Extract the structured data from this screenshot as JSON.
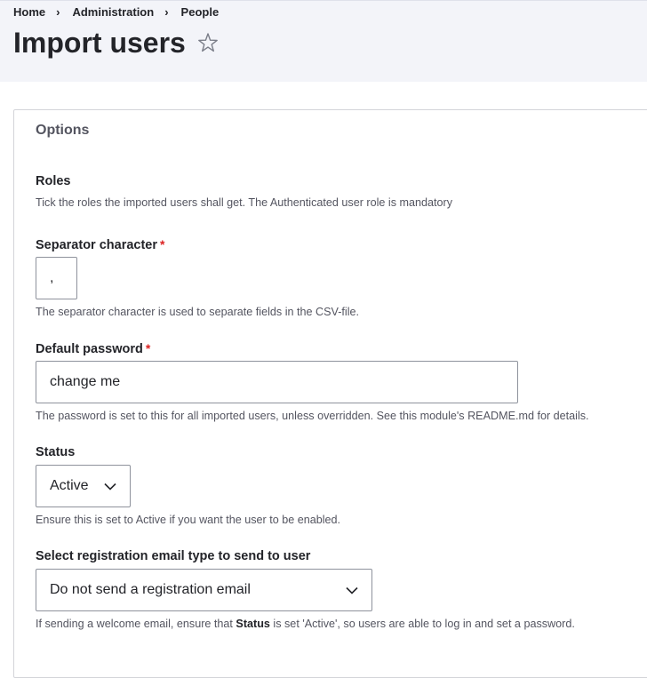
{
  "breadcrumb": {
    "items": [
      "Home",
      "Administration",
      "People"
    ],
    "separator": "›"
  },
  "header": {
    "title": "Import users",
    "star_icon": "star-outline-icon"
  },
  "options": {
    "legend": "Options",
    "roles": {
      "label": "Roles",
      "description": "Tick the roles the imported users shall get. The Authenticated user role is mandatory"
    },
    "separator": {
      "label": "Separator character",
      "required_mark": "*",
      "value": ",",
      "description": "The separator character is used to separate fields in the CSV-file."
    },
    "password": {
      "label": "Default password",
      "required_mark": "*",
      "value": "change me",
      "description": "The password is set to this for all imported users, unless overridden. See this module's README.md for details."
    },
    "status": {
      "label": "Status",
      "selected": "Active",
      "description": "Ensure this is set to Active if you want the user to be enabled."
    },
    "registration_email": {
      "label": "Select registration email type to send to user",
      "selected": "Do not send a registration email",
      "description_prefix": "If sending a welcome email, ensure that ",
      "description_bold": "Status",
      "description_suffix": " is set 'Active', so users are able to log in and set a password."
    }
  },
  "colors": {
    "header_bg": "#f3f4f9",
    "required": "#dc2323",
    "text": "#232429",
    "muted": "#545560"
  }
}
